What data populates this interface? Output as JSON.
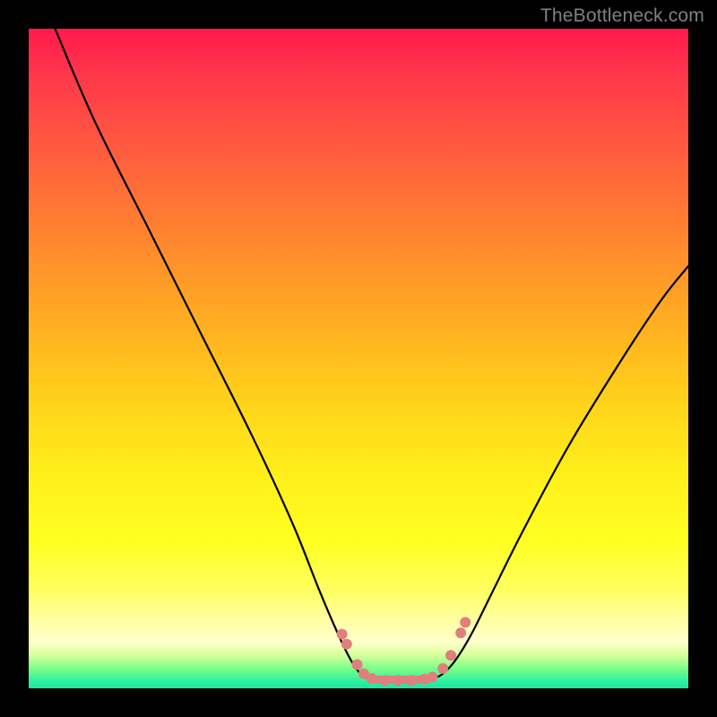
{
  "watermark": "TheBottleneck.com",
  "chart_data": {
    "type": "line",
    "title": "",
    "xlabel": "",
    "ylabel": "",
    "xlim": [
      0,
      100
    ],
    "ylim": [
      0,
      100
    ],
    "grid": false,
    "legend": false,
    "background_gradient_stops": [
      {
        "pos": 0,
        "color": "#ff1a4d"
      },
      {
        "pos": 50,
        "color": "#ffd61a"
      },
      {
        "pos": 90,
        "color": "#ffffcc"
      },
      {
        "pos": 100,
        "color": "#18e6a0"
      }
    ],
    "series": [
      {
        "name": "left-curve",
        "x": [
          4,
          10,
          18,
          26,
          34,
          40,
          44,
          47,
          49,
          50.5,
          51.5
        ],
        "y": [
          100,
          86,
          70,
          54,
          38,
          25,
          15,
          8,
          4,
          2,
          1.5
        ]
      },
      {
        "name": "right-curve",
        "x": [
          61,
          62.5,
          64.5,
          67,
          70,
          75,
          82,
          90,
          96,
          100
        ],
        "y": [
          1.5,
          2,
          4,
          8,
          14,
          24,
          37,
          50,
          59,
          64
        ]
      },
      {
        "name": "floor-segment",
        "x": [
          51.5,
          54,
          57,
          60,
          61
        ],
        "y": [
          1.5,
          1.2,
          1.2,
          1.3,
          1.5
        ]
      }
    ],
    "markers": {
      "name": "highlight-dots",
      "color": "#e17e7e",
      "radius_px": 6,
      "points": [
        {
          "x": 47.5,
          "y": 8.2
        },
        {
          "x": 48.2,
          "y": 6.7
        },
        {
          "x": 49.8,
          "y": 3.6
        },
        {
          "x": 50.8,
          "y": 2.2
        },
        {
          "x": 52.0,
          "y": 1.5
        },
        {
          "x": 54.0,
          "y": 1.2
        },
        {
          "x": 56.0,
          "y": 1.2
        },
        {
          "x": 58.0,
          "y": 1.2
        },
        {
          "x": 60.0,
          "y": 1.4
        },
        {
          "x": 61.2,
          "y": 1.7
        },
        {
          "x": 62.8,
          "y": 3.0
        },
        {
          "x": 64.0,
          "y": 5.0
        },
        {
          "x": 65.5,
          "y": 8.4
        },
        {
          "x": 66.2,
          "y": 10.0
        }
      ]
    },
    "floor_bar": {
      "color": "#e17e7e",
      "x_start": 51.5,
      "x_end": 61.0,
      "thickness_px": 9,
      "y": 1.3
    }
  }
}
